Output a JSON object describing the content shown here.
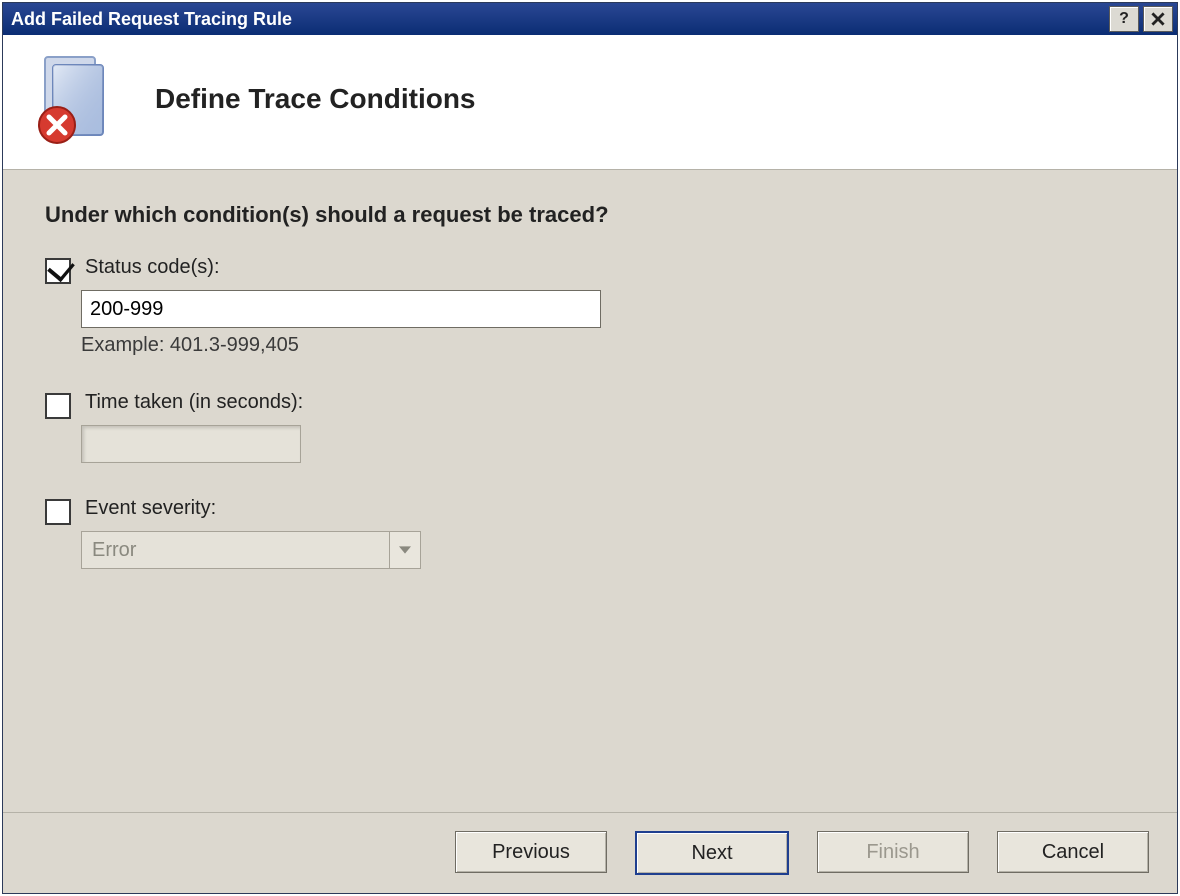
{
  "titlebar": {
    "title": "Add Failed Request Tracing Rule"
  },
  "header": {
    "heading": "Define Trace Conditions"
  },
  "body": {
    "prompt": "Under which condition(s) should a request be traced?",
    "status_codes": {
      "checked": true,
      "label": "Status code(s):",
      "value": "200-999",
      "example": "Example: 401.3-999,405"
    },
    "time_taken": {
      "checked": false,
      "label": "Time taken (in seconds):",
      "value": ""
    },
    "event_severity": {
      "checked": false,
      "label": "Event severity:",
      "selected": "Error"
    }
  },
  "footer": {
    "previous": "Previous",
    "next": "Next",
    "finish": "Finish",
    "cancel": "Cancel"
  }
}
